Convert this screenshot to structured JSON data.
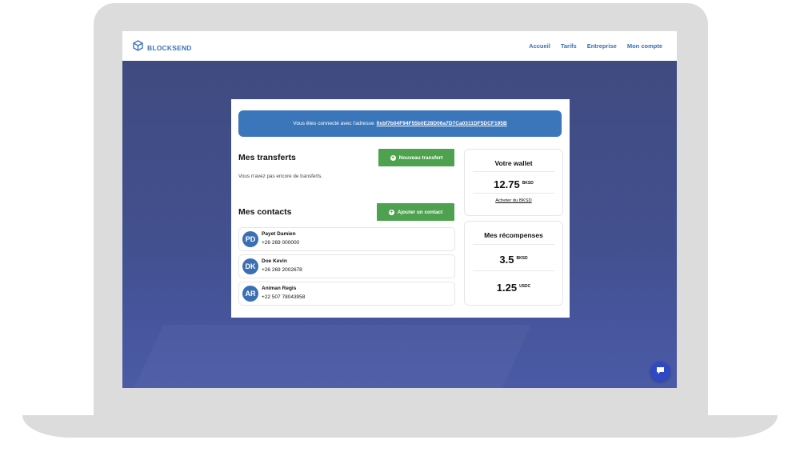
{
  "brand": {
    "name": "BLOCKSEND"
  },
  "nav": {
    "items": [
      "Accueil",
      "Tarifs",
      "Entreprise",
      "Mon compte"
    ]
  },
  "banner": {
    "text": "Vous êtes connecté avec l'adresse",
    "address": "0xbf7b04F94F55b0E28D06a7D7Ca0311DF5DCF195B"
  },
  "transfers": {
    "title": "Mes transferts",
    "new_button": "Nouveau transfert",
    "empty_text": "Vous n'avez pas encore de transferts."
  },
  "contacts": {
    "title": "Mes contacts",
    "add_button": "Ajouter un contact",
    "items": [
      {
        "initials": "PD",
        "name": "Payet Damien",
        "phone": "+26 269 000000"
      },
      {
        "initials": "DK",
        "name": "Doe Kevin",
        "phone": "+26 269 2002678"
      },
      {
        "initials": "AR",
        "name": "Animan Regis",
        "phone": "+22 507 78043958"
      }
    ]
  },
  "wallet": {
    "title": "Votre wallet",
    "amount": "12.75",
    "unit": "BKSD",
    "buy_link": "Acheter du BKSD"
  },
  "rewards": {
    "title": "Mes récompenses",
    "items": [
      {
        "amount": "3.5",
        "unit": "BKSD"
      },
      {
        "amount": "1.25",
        "unit": "USDC"
      }
    ]
  },
  "colors": {
    "background": "#44508e",
    "primary": "#3b76bb",
    "success": "#4ea14e",
    "chat": "#2f49c4"
  },
  "icons": {
    "brand": "cube-logo-icon",
    "add": "plus-circle-icon",
    "chat": "chat-bubble-icon"
  }
}
